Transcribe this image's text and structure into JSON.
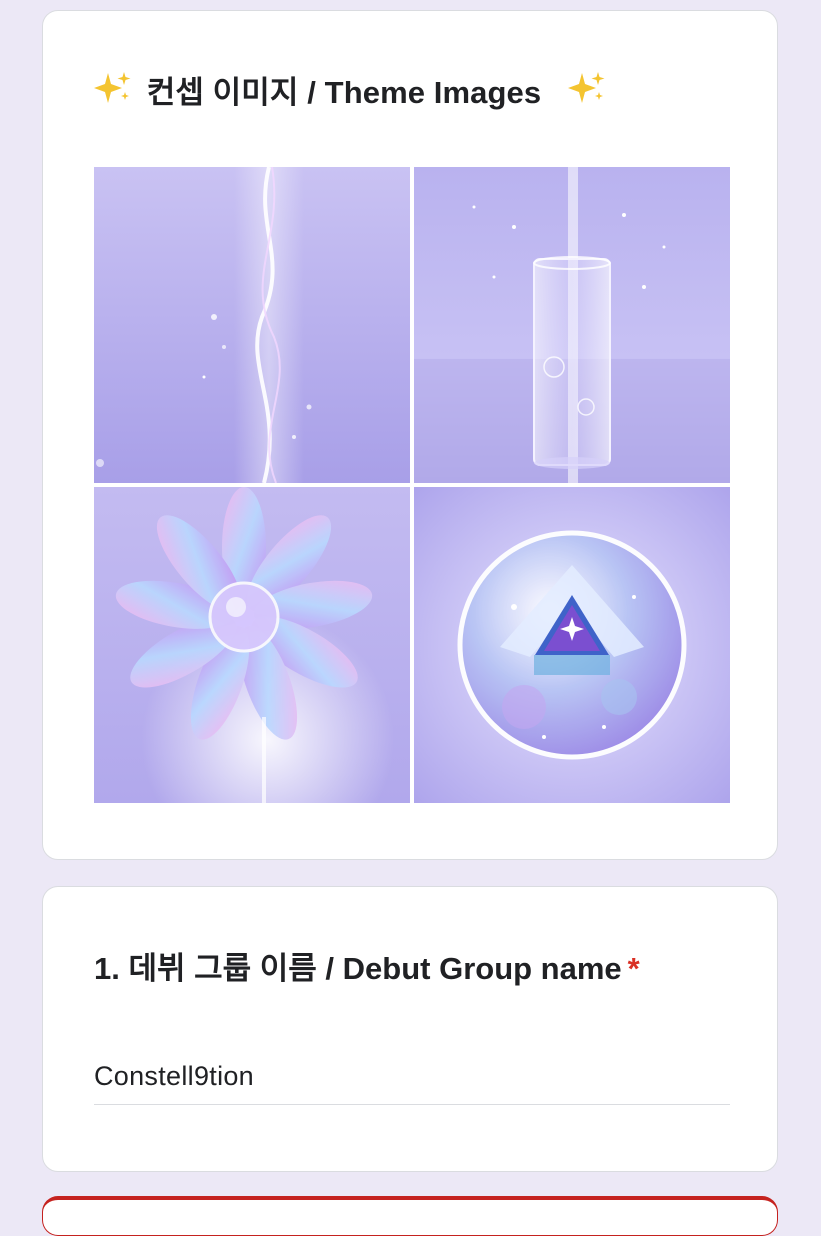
{
  "theme_section": {
    "title": "컨셉 이미지 / Theme Images",
    "decor_icon": "sparkles-icon",
    "images": [
      {
        "name": "light-beam-image",
        "icon": "light-beam"
      },
      {
        "name": "water-glass-image",
        "icon": "glass-of-water"
      },
      {
        "name": "crystal-flower-image",
        "icon": "iridescent-flower"
      },
      {
        "name": "crystal-orb-image",
        "icon": "crystal-orb-with-star"
      }
    ],
    "colors": {
      "accent": "#f2c94c",
      "image_base": "#b7aef0"
    }
  },
  "question_1": {
    "title": "1. 데뷔 그룹 이름 / Debut Group name",
    "required_mark": "*",
    "answer": "Constell9tion"
  },
  "colors": {
    "page_background": "#ece8f6",
    "card_background": "#ffffff",
    "required": "#d93025"
  }
}
